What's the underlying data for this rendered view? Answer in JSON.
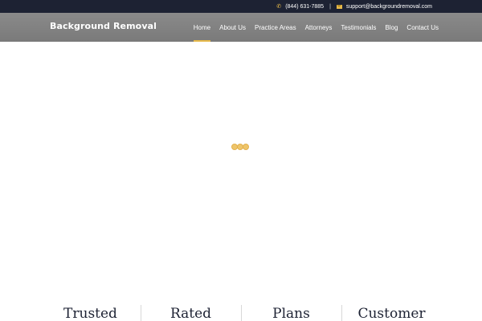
{
  "topbar": {
    "phone": "(844) 631-7885",
    "separator": "|",
    "email": "support@backgroundremoval.com",
    "phone_icon": "phone-icon",
    "email_icon": "envelope-icon"
  },
  "header": {
    "logo": "Background Removal",
    "nav": [
      {
        "label": "Home",
        "active": true
      },
      {
        "label": "About Us",
        "active": false
      },
      {
        "label": "Practice Areas",
        "active": false
      },
      {
        "label": "Attorneys",
        "active": false
      },
      {
        "label": "Testimonials",
        "active": false
      },
      {
        "label": "Blog",
        "active": false
      },
      {
        "label": "Contact Us",
        "active": false
      }
    ]
  },
  "features": [
    {
      "title": "Trusted"
    },
    {
      "title": "Rated"
    },
    {
      "title": "Plans"
    },
    {
      "title": "Customer"
    }
  ],
  "colors": {
    "topbar_bg": "#1d2233",
    "accent": "#e6b94a",
    "nav_bg": "#808080"
  }
}
